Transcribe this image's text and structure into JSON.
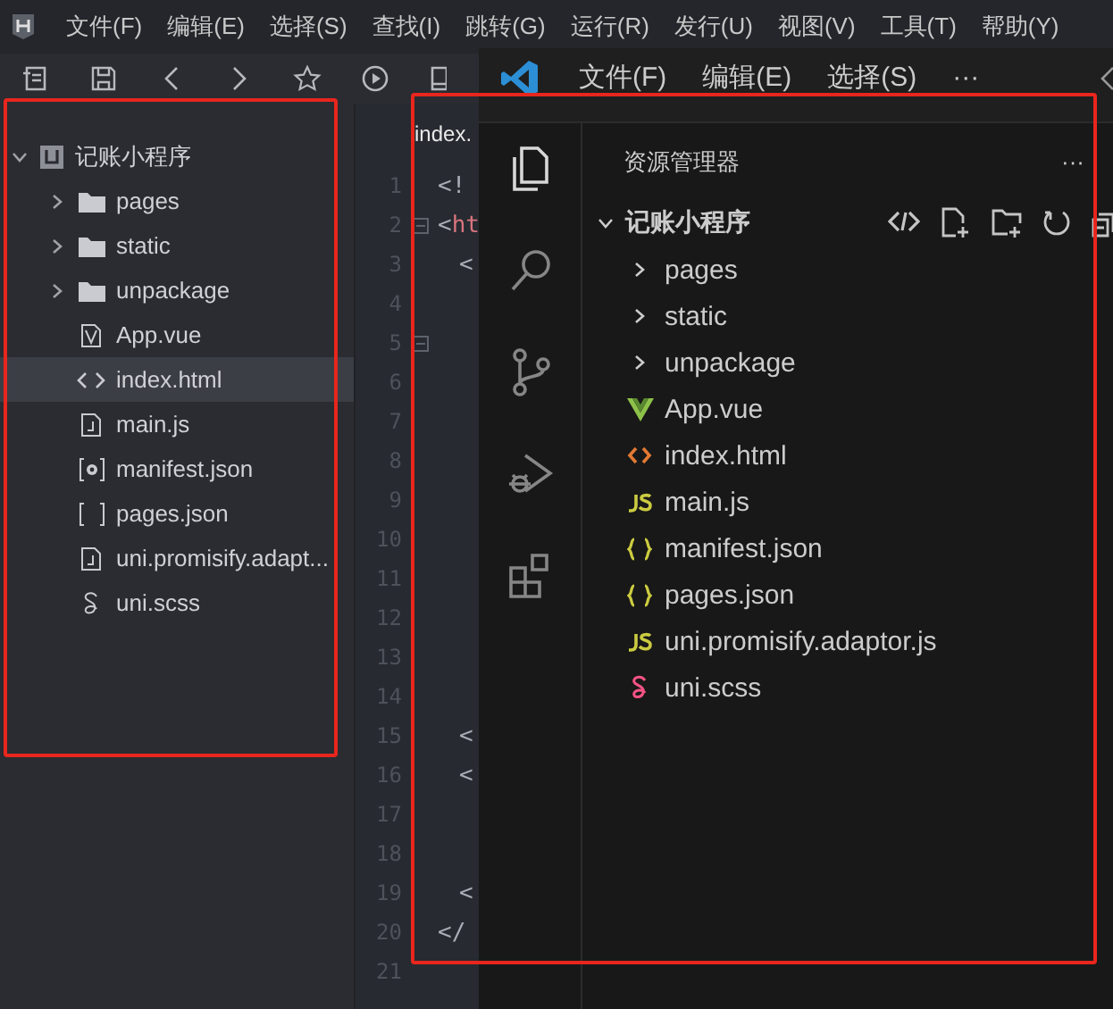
{
  "hbuilder": {
    "menu": [
      "文件(F)",
      "编辑(E)",
      "选择(S)",
      "查找(I)",
      "跳转(G)",
      "运行(R)",
      "发行(U)",
      "视图(V)",
      "工具(T)",
      "帮助(Y)"
    ],
    "explorer": {
      "root": {
        "name": "记账小程序",
        "expanded": true
      },
      "items": [
        {
          "name": "pages",
          "kind": "folder",
          "expanded": false,
          "selected": false
        },
        {
          "name": "static",
          "kind": "folder",
          "expanded": false,
          "selected": false
        },
        {
          "name": "unpackage",
          "kind": "folder",
          "expanded": false,
          "selected": false
        },
        {
          "name": "App.vue",
          "kind": "vue",
          "selected": false
        },
        {
          "name": "index.html",
          "kind": "html",
          "selected": true
        },
        {
          "name": "main.js",
          "kind": "js",
          "selected": false
        },
        {
          "name": "manifest.json",
          "kind": "manifest",
          "selected": false
        },
        {
          "name": "pages.json",
          "kind": "json",
          "selected": false
        },
        {
          "name": "uni.promisify.adapt...",
          "kind": "js",
          "selected": false
        },
        {
          "name": "uni.scss",
          "kind": "scss",
          "selected": false
        }
      ]
    },
    "editor": {
      "tab": "index.",
      "lines": [
        {
          "number": "1",
          "punct": "<!"
        },
        {
          "number": "2",
          "punct": "<",
          "tag": "ht",
          "fold": true
        },
        {
          "number": "3",
          "punct": "<",
          "indent": true
        },
        {
          "number": "4"
        },
        {
          "number": "5",
          "fold": true
        },
        {
          "number": "6"
        },
        {
          "number": "7"
        },
        {
          "number": "8"
        },
        {
          "number": "9"
        },
        {
          "number": "10"
        },
        {
          "number": "11"
        },
        {
          "number": "12"
        },
        {
          "number": "13"
        },
        {
          "number": "14"
        },
        {
          "number": "15",
          "punct": "<",
          "indent": true
        },
        {
          "number": "16",
          "punct": "<",
          "indent": true
        },
        {
          "number": "17"
        },
        {
          "number": "18"
        },
        {
          "number": "19",
          "punct": "<",
          "indent": true
        },
        {
          "number": "20",
          "punct": "</"
        },
        {
          "number": "21"
        }
      ]
    }
  },
  "vscode": {
    "menu": [
      "文件(F)",
      "编辑(E)",
      "选择(S)",
      "···"
    ],
    "activity": [
      {
        "kind": "files",
        "selected": true
      },
      {
        "kind": "search",
        "selected": false
      },
      {
        "kind": "git",
        "selected": false
      },
      {
        "kind": "debug",
        "selected": false
      },
      {
        "kind": "extensions",
        "selected": false
      }
    ],
    "explorer": {
      "title": "资源管理器",
      "more": "···",
      "folder": {
        "name": "记账小程序",
        "expanded": true
      },
      "items": [
        {
          "name": "pages",
          "kind": "folder",
          "expanded": false
        },
        {
          "name": "static",
          "kind": "folder",
          "expanded": false
        },
        {
          "name": "unpackage",
          "kind": "folder",
          "expanded": false
        },
        {
          "name": "App.vue",
          "kind": "vue"
        },
        {
          "name": "index.html",
          "kind": "html"
        },
        {
          "name": "main.js",
          "kind": "js"
        },
        {
          "name": "manifest.json",
          "kind": "json"
        },
        {
          "name": "pages.json",
          "kind": "json"
        },
        {
          "name": "uni.promisify.adaptor.js",
          "kind": "js"
        },
        {
          "name": "uni.scss",
          "kind": "scss"
        }
      ]
    }
  }
}
